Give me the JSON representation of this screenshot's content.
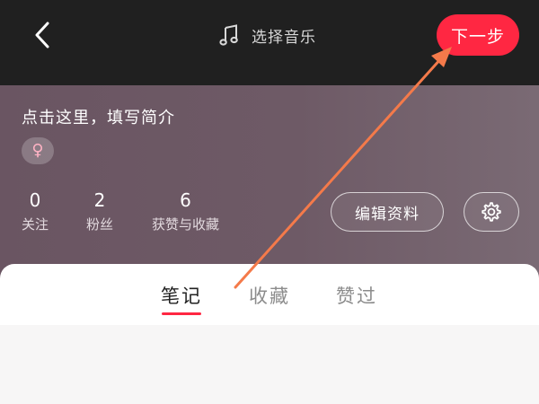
{
  "header": {
    "music_label": "选择音乐",
    "next_label": "下一步"
  },
  "profile": {
    "bio_placeholder": "点击这里，填写简介",
    "gender_symbol": "♀",
    "stats": [
      {
        "value": "0",
        "label": "关注"
      },
      {
        "value": "2",
        "label": "粉丝"
      },
      {
        "value": "6",
        "label": "获赞与收藏"
      }
    ],
    "edit_label": "编辑资料"
  },
  "tabs": [
    {
      "label": "笔记",
      "active": true
    },
    {
      "label": "收藏",
      "active": false
    },
    {
      "label": "赞过",
      "active": false
    }
  ],
  "colors": {
    "accent": "#ff2742",
    "annotation_arrow": "#f47a4a"
  }
}
